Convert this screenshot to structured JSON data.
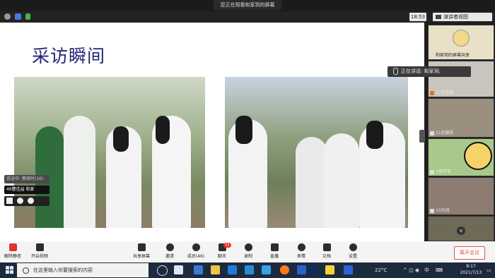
{
  "window": {
    "share_title": "您正在观看和家玥的屏幕",
    "time_chip": "18:53",
    "view_label": "演讲者视图"
  },
  "slide": {
    "title": "采访瞬间"
  },
  "speaking": {
    "label": "正在讲话: 和家玥;"
  },
  "participants": [
    {
      "label": "和家玥的屏幕共享"
    },
    {
      "label": "13罗嘉璐"
    },
    {
      "label": "31武颢铄"
    },
    {
      "label": "5崔梓萱"
    },
    {
      "label": "19刘润"
    }
  ],
  "left_panel": {
    "row1": "说话中: 蔡丽时(16)",
    "row2": "46曹佳益 和家"
  },
  "toolbar": {
    "mute": "解除静音",
    "video": "开启视频",
    "share": "共享屏幕",
    "invite": "邀请",
    "members": "成员(46)",
    "chat": "聊天",
    "chat_badge": "11",
    "record": "录制",
    "live": "直播",
    "reactions": "表情",
    "docs": "文档",
    "settings": "设置",
    "end": "离开会议"
  },
  "taskbar": {
    "search_placeholder": "在这里输入你要搜索的内容",
    "weather": "22°C",
    "ime": "中",
    "time": "8:17",
    "date": "2021/7/13"
  },
  "colors": {
    "title": "#23237a",
    "end": "#e34d4d",
    "taskbar": "#1c2a3e"
  }
}
